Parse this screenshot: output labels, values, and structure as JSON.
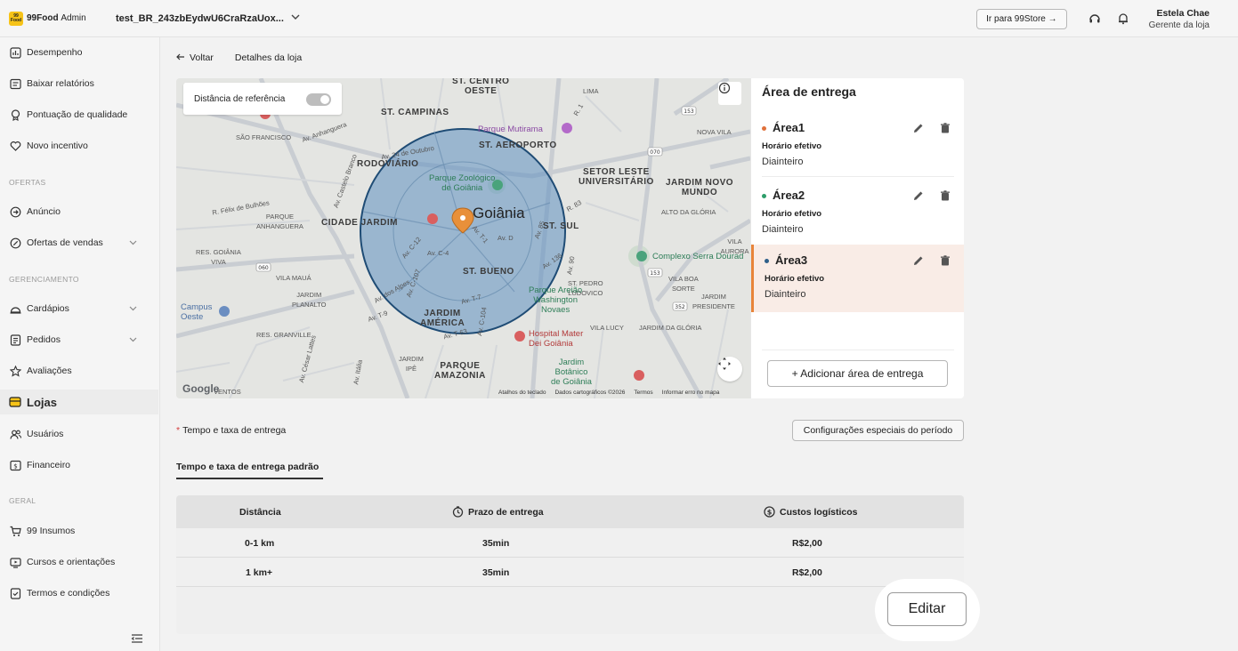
{
  "header": {
    "brand_logo": "99 Food",
    "brand_name": "99Food",
    "brand_suffix": "Admin",
    "store_name": "test_BR_243zbEydwU6CraRzaUox...",
    "go_store_label": "Ir para 99Store →",
    "user_name": "Estela Chae",
    "user_role": "Gerente da loja"
  },
  "sidebar": {
    "items": [
      {
        "label": "Desempenho",
        "icon": "chart-icon"
      },
      {
        "label": "Baixar relatórios",
        "icon": "report-icon"
      },
      {
        "label": "Pontuação de qualidade",
        "icon": "badge-icon"
      },
      {
        "label": "Novo incentivo",
        "icon": "heart-icon"
      },
      {
        "label": "Anúncio",
        "icon": "arrow-circle-icon"
      },
      {
        "label": "Ofertas de vendas",
        "icon": "percent-icon"
      },
      {
        "label": "Cardápios",
        "icon": "cloche-icon"
      },
      {
        "label": "Pedidos",
        "icon": "list-icon"
      },
      {
        "label": "Avaliações",
        "icon": "star-icon"
      },
      {
        "label": "Lojas",
        "icon": "store-icon"
      },
      {
        "label": "Usuários",
        "icon": "users-icon"
      },
      {
        "label": "Financeiro",
        "icon": "money-icon"
      },
      {
        "label": "99 Insumos",
        "icon": "cart-icon"
      },
      {
        "label": "Cursos e orientações",
        "icon": "courses-icon"
      },
      {
        "label": "Termos e condições",
        "icon": "terms-icon"
      }
    ],
    "sections": {
      "ofertas": "OFERTAS",
      "gerenciamento": "GERENCIAMENTO",
      "geral": "GERAL"
    }
  },
  "breadcrumb": {
    "back_label": "Voltar",
    "current": "Detalhes da loja"
  },
  "map": {
    "ref_distance_label": "Distância de referência",
    "city": "Goiânia",
    "labels": {
      "st_centro_oeste": "ST. CENTRO\nOESTE",
      "st_campinas": "ST. CAMPINAS",
      "sao_francisco": "SÃO FRANCISCO",
      "st_aeroporto": "ST. AEROPORTO",
      "rodoviario": "RODOVIÁRIO",
      "setor_leste": "SETOR LESTE\nUNIVERSITÁRIO",
      "jardim_novo_mundo": "JARDIM NOVO\nMUNDO",
      "cidade_jardim": "CIDADE JARDIM",
      "st_sul": "ST. SUL",
      "st_bueno": "ST. BUENO",
      "jardim_america": "JARDIM\nAMÉRICA",
      "parque_amazonia": "PARQUE\nAMAZONIA",
      "res_granville": "RES. GRANVILLE",
      "parque_mutirama": "Parque Mutirama",
      "parque_zoologico": "Parque Zoológico\nde Goiânia",
      "complexo_serra": "Complexo Serra Dourad",
      "parque_areiao": "Parque Areião\nWashington\nNovaes",
      "hospital_mater": "Hospital Mater\nDei Goiânia",
      "jardim_botanico": "Jardim\nBotânico\nde Goiânia",
      "campus_oeste": "Campus\nOeste",
      "vila_maua": "VILA MAUÁ",
      "res_goiania_viva": "RES. GOIÂNIA\nVIVA",
      "jardim_planalto": "JARDIM\nPLANALTO",
      "parque_anhanguera": "PARQUE\nANHANGUERA",
      "vila_aurora": "VILA AURORA",
      "vila_boa_sorte": "VILA BOA\nSORTE",
      "jardim_da_gloria": "JARDIM DA GLÓRIA",
      "vila_lucy": "VILA LUCY",
      "jardim_ipe": "JARDIM\nIPÊ",
      "ventos": "VENTOS",
      "lima": "LIMA",
      "nova_vila": "NOVA VILA",
      "alto_da_gloria": "ALTO DA GLÓRIA",
      "jardim_presidente": "JARDIM\nPRESIDENTE",
      "st_pedro_ludovico": "ST. PEDRO\nLUDOVICO"
    },
    "roads": {
      "av_anhanguera": "Av. Anhanguera",
      "av_24_outubro": "Av. 24 de Outubro",
      "av_castelo_branco": "Av. Castelo Branco",
      "r_felix_bulhoes": "R. Félix de Bulhões",
      "av_c12": "Av. C-12",
      "av_c4": "Av. C-4",
      "av_t1": "Av. T-1",
      "av_d": "Av. D",
      "av_t7": "Av. T-7",
      "av_t9": "Av. T-9",
      "av_dos_alpes": "Av. dos Alpes",
      "av_t63": "Av. T-63",
      "av_c107": "Av. C-107",
      "av_c104": "Av. C-104",
      "av_136": "Av. 136",
      "av_85": "Av. 85",
      "av_90": "Av. 90",
      "r_83": "R. 83",
      "av_cesar_lattes": "Av. César Lattes",
      "av_italia": "Av. Itália",
      "r_1": "R. 1"
    },
    "footer": [
      "Atalhos do teclado",
      "Dados cartográficos ©2026",
      "Termos",
      "Informar erro no mapa"
    ],
    "google": "Google",
    "route_shields": [
      "060",
      "153",
      "352",
      "070"
    ],
    "zone_color": "#2f5f8a"
  },
  "area_panel": {
    "title": "Área de entrega",
    "areas": [
      {
        "name": "Área1",
        "sub1": "Horário efetivo",
        "sub2": "Diainteiro",
        "dot_color": "#e0713b"
      },
      {
        "name": "Área2",
        "sub1": "Horário efetivo",
        "sub2": "Diainteiro",
        "dot_color": "#2d9d6a"
      },
      {
        "name": "Área3",
        "sub1": "Horário efetivo",
        "sub2": "Diainteiro",
        "dot_color": "#2f5f8a"
      }
    ],
    "add_label": "+ Adicionar área de entrega"
  },
  "delivery": {
    "section_required": "*",
    "section_label": "Tempo e taxa de entrega",
    "config_button": "Configurações especiais do período",
    "tab_label": "Tempo e taxa de entrega padrão",
    "columns": [
      "Distância",
      "Prazo de entrega",
      "Custos logísticos"
    ],
    "rows": [
      {
        "distance": "0-1 km",
        "time": "35min",
        "cost": "R$2,00"
      },
      {
        "distance": "1 km+",
        "time": "35min",
        "cost": "R$2,00"
      }
    ],
    "edit_label": "Editar"
  }
}
